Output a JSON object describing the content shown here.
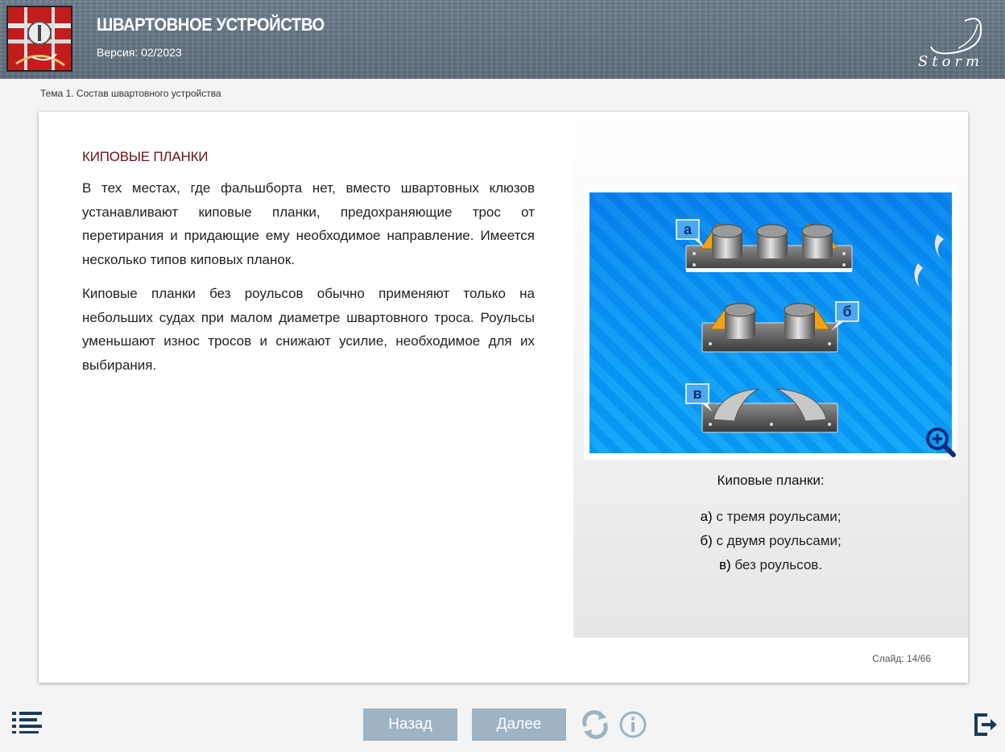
{
  "header": {
    "title": "ШВАРТОВНОЕ УСТРОЙСТВО",
    "version": "Версия: 02/2023",
    "brand": "Storm"
  },
  "breadcrumb": "Тема 1. Состав швартовного устройства",
  "content": {
    "section_title": "КИПОВЫЕ ПЛАНКИ",
    "paragraphs": [
      "В тех местах, где фальшборта нет, вместо швартовных клюзов устанавливают киповые планки, предохраняющие трос от перетирания и придающие ему необходимое направление. Имеется несколько типов киповых планок.",
      "Киповые планки без роульсов обычно применяют только на небольших судах при малом диаметре швартовного троса. Роульсы уменьшают износ тросов и снижают усилие, необходимое для их выбирания."
    ]
  },
  "figure": {
    "labels": [
      "а",
      "б",
      "в"
    ],
    "caption_title": "Киповые планки:",
    "caption_items": [
      {
        "key": "а)",
        "text": " с тремя роульсами;"
      },
      {
        "key": "б)",
        "text": " с двумя роульсами;"
      },
      {
        "key": "в)",
        "text": " без роульсов."
      }
    ],
    "background_color": "#0a8ff0",
    "plate_accent": "#f0a318"
  },
  "slide": {
    "label": "Слайд:",
    "current": "14",
    "total": "66",
    "text": "Слайд:  14/66"
  },
  "navigation": {
    "back_label": "Назад",
    "next_label": "Далее",
    "button_color": "#9eb3c4",
    "icons": [
      "menu-icon",
      "reload-icon",
      "info-icon",
      "exit-icon"
    ]
  }
}
